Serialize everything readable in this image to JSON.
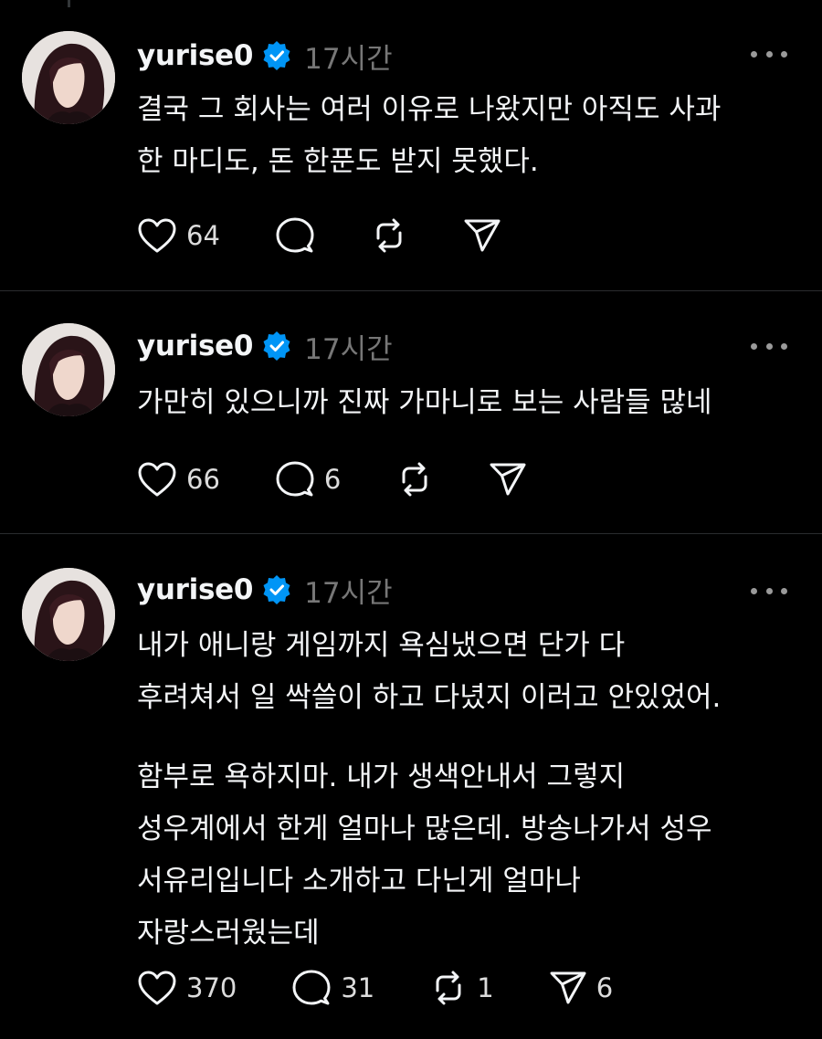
{
  "colors": {
    "background": "#000000",
    "text": "#f3f5f7",
    "muted": "#777777",
    "verified": "#0095f6",
    "divider": "#2a2c2e"
  },
  "posts": [
    {
      "username": "yurise0",
      "verified": true,
      "time": "17시간",
      "paragraphs": [
        "결국 그 회사는 여러 이유로 나왔지만 아직도 사과\n한 마디도, 돈 한푼도 받지 못했다."
      ],
      "likes": "64",
      "replies": "",
      "reposts": "",
      "shares": ""
    },
    {
      "username": "yurise0",
      "verified": true,
      "time": "17시간",
      "paragraphs": [
        "가만히 있으니까 진짜 가마니로 보는 사람들 많네"
      ],
      "likes": "66",
      "replies": "6",
      "reposts": "",
      "shares": ""
    },
    {
      "username": "yurise0",
      "verified": true,
      "time": "17시간",
      "paragraphs": [
        "내가 애니랑 게임까지 욕심냈으면 단가 다\n후려쳐서 일 싹쓸이 하고 다녔지 이러고 안있었어.",
        "함부로 욕하지마. 내가 생색안내서 그렇지\n성우계에서 한게 얼마나 많은데. 방송나가서 성우\n서유리입니다 소개하고 다닌게 얼마나\n자랑스러웠는데"
      ],
      "likes": "370",
      "replies": "31",
      "reposts": "1",
      "shares": "6"
    }
  ],
  "icons": {
    "like": "heart-icon",
    "reply": "speech-bubble-icon",
    "repost": "repost-icon",
    "share": "paper-plane-icon",
    "more": "more-options-icon",
    "verified": "verified-badge-icon"
  }
}
